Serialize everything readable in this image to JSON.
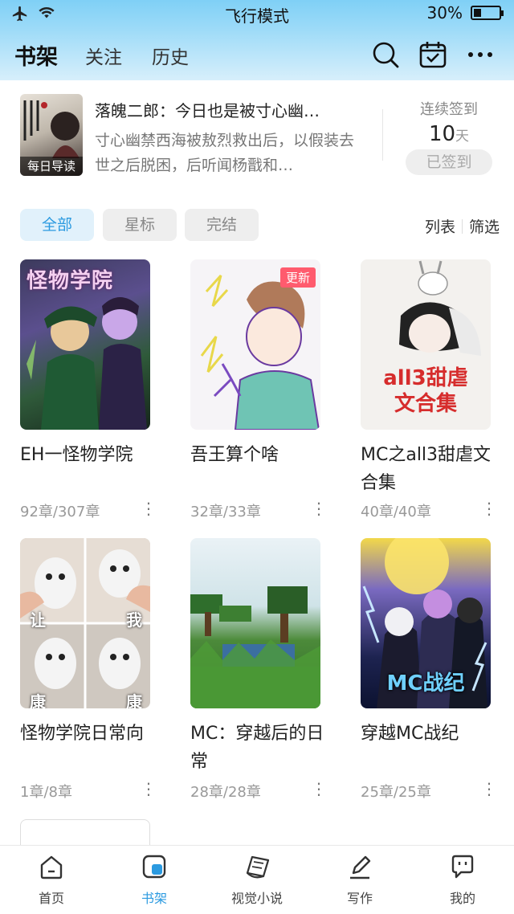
{
  "status_bar": {
    "mode": "飞行模式",
    "battery": "30%",
    "battery_level": 0.3
  },
  "header": {
    "tabs": [
      {
        "label": "书架",
        "active": true
      },
      {
        "label": "关注",
        "active": false
      },
      {
        "label": "历史",
        "active": false
      }
    ],
    "icons": [
      "search-icon",
      "calendar-check-icon",
      "more-icon"
    ]
  },
  "reading": {
    "badge": "每日导读",
    "title": "落魄二郎：今日也是被寸心幽…",
    "description": "寸心幽禁西海被敖烈救出后，以假装去世之后脱困，后听闻杨戬和…",
    "checkin_label": "连续签到",
    "checkin_days": "10",
    "checkin_unit": "天",
    "checkin_button": "已签到"
  },
  "filters": {
    "chips": [
      {
        "label": "全部",
        "active": true
      },
      {
        "label": "星标",
        "active": false
      },
      {
        "label": "完结",
        "active": false
      }
    ],
    "list_label": "列表",
    "filter_label": "筛选"
  },
  "books": [
    {
      "title": "EH一怪物学院",
      "progress": "92章/307章",
      "badge": "",
      "cover_text": "怪物学院"
    },
    {
      "title": "吾王算个啥",
      "progress": "32章/33章",
      "badge": "更新",
      "cover_text": ""
    },
    {
      "title": "MC之all3甜虐文合集",
      "progress": "40章/40章",
      "badge": "",
      "cover_text": "all3甜虐文合集"
    },
    {
      "title": "怪物学院日常向",
      "progress": "1章/8章",
      "badge": "",
      "cover_text": ""
    },
    {
      "title": "MC：穿越后的日常",
      "progress": "28章/28章",
      "badge": "",
      "cover_text": ""
    },
    {
      "title": "穿越MC战纪",
      "progress": "25章/25章",
      "badge": "",
      "cover_text": "MC战纪"
    }
  ],
  "cover_captions": {
    "l1": "让",
    "r1": "我",
    "l2": "康",
    "r2": "康"
  },
  "more_glyph": "⋮",
  "tabbar": [
    {
      "label": "首页",
      "icon": "home-icon",
      "active": false
    },
    {
      "label": "书架",
      "icon": "bookshelf-icon",
      "active": true
    },
    {
      "label": "视觉小说",
      "icon": "book-icon",
      "active": false
    },
    {
      "label": "写作",
      "icon": "pen-icon",
      "active": false
    },
    {
      "label": "我的",
      "icon": "chat-icon",
      "active": false
    }
  ],
  "colors": {
    "accent": "#2b9ae0",
    "update_badge": "#ff5b6e",
    "header_top": "#7fd0f6"
  }
}
